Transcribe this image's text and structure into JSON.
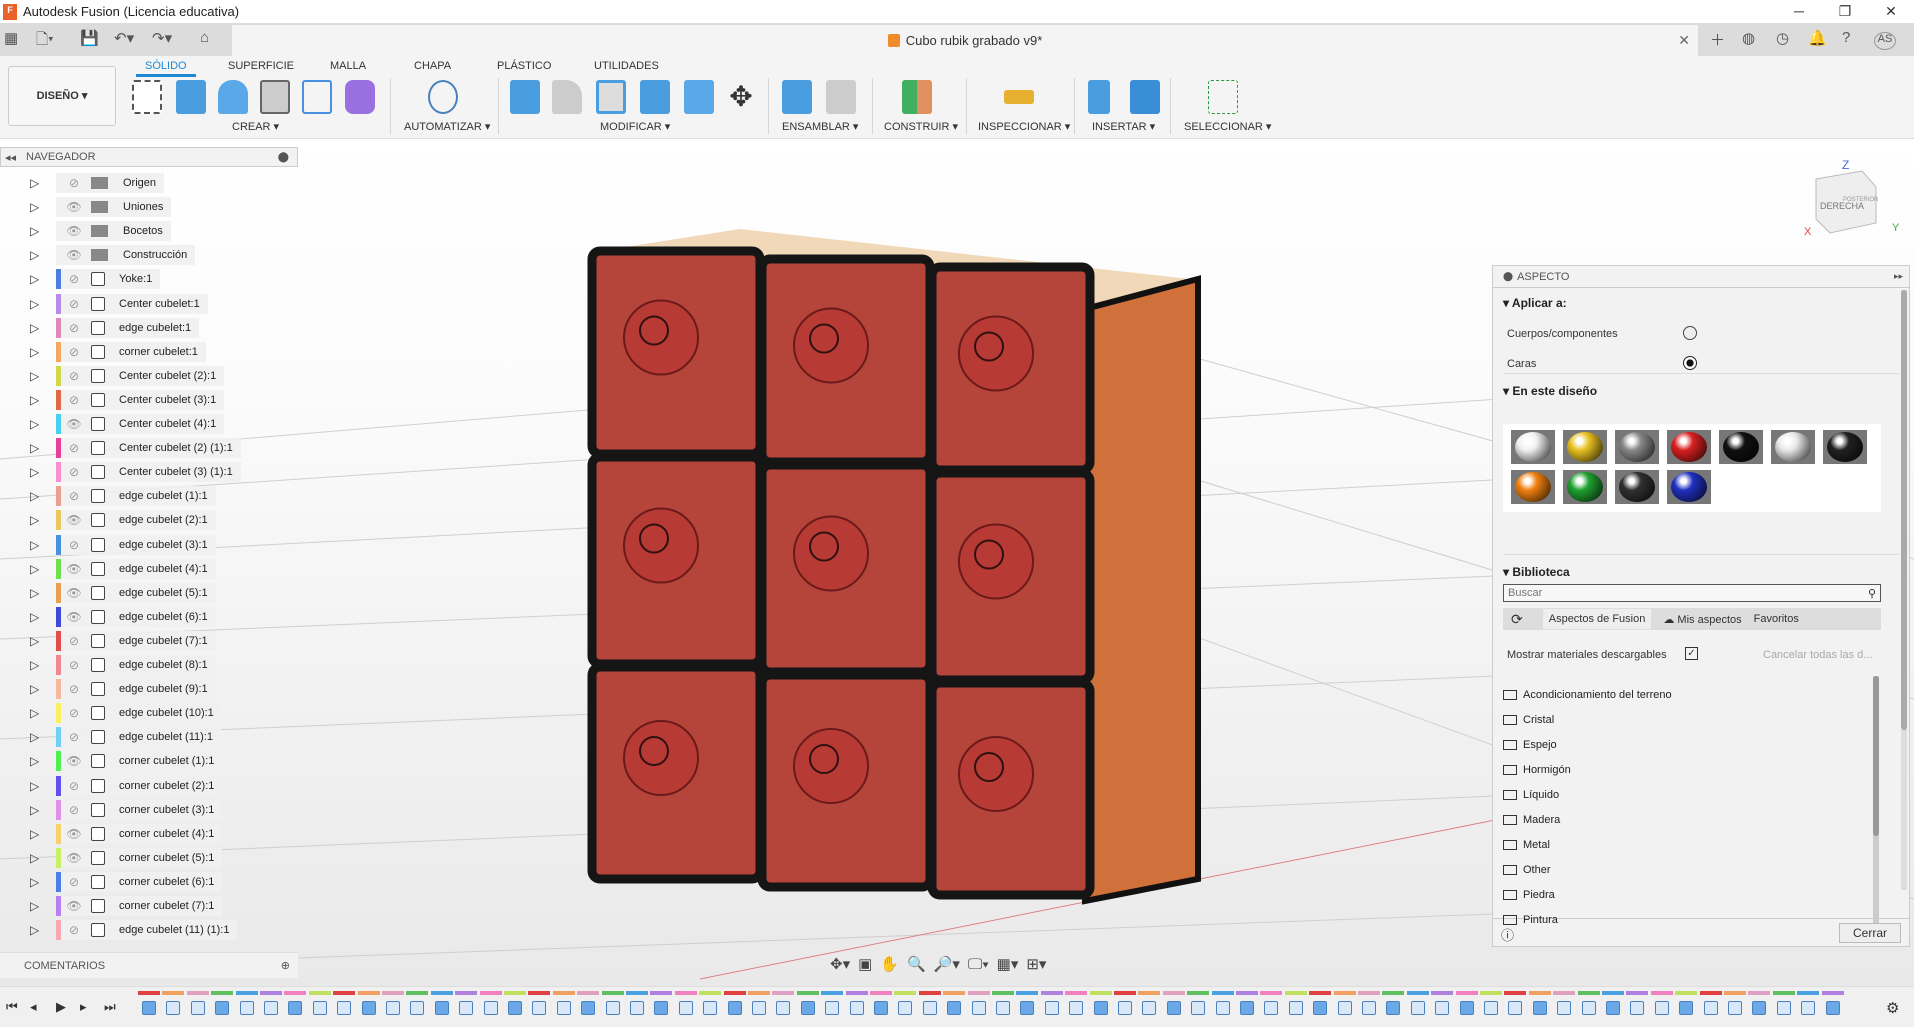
{
  "app": {
    "title": "Autodesk Fusion (Licencia educativa)",
    "document": "Cubo rubik grabado v9*"
  },
  "window": {
    "minimize": "─",
    "maximize": "❐",
    "close": "✕"
  },
  "ribbon": {
    "workspace": "DISEÑO ▾",
    "tabs": [
      {
        "label": "SÓLIDO",
        "active": true
      },
      {
        "label": "SUPERFICIE"
      },
      {
        "label": "MALLA"
      },
      {
        "label": "CHAPA"
      },
      {
        "label": "PLÁSTICO"
      },
      {
        "label": "UTILIDADES"
      }
    ],
    "groups": [
      "CREAR ▾",
      "AUTOMATIZAR ▾",
      "MODIFICAR ▾",
      "ENSAMBLAR ▾",
      "CONSTRUIR ▾",
      "INSPECCIONAR ▾",
      "INSERTAR ▾",
      "SELECCIONAR ▾"
    ]
  },
  "user": {
    "initials": "AS"
  },
  "navigator": {
    "title": "NAVEGADOR",
    "folders": [
      {
        "label": "Origen",
        "visible": false
      },
      {
        "label": "Uniones",
        "visible": true
      },
      {
        "label": "Bocetos",
        "visible": true
      },
      {
        "label": "Construcción",
        "visible": true
      }
    ],
    "components": [
      {
        "label": "Yoke:1",
        "color": "#4a7fe0",
        "visible": false,
        "icon": "body"
      },
      {
        "label": "Center cubelet:1",
        "color": "#b98be8",
        "visible": false,
        "icon": "body"
      },
      {
        "label": "edge cubelet:1",
        "color": "#e08ab8",
        "visible": false,
        "icon": "body"
      },
      {
        "label": "corner cubelet:1",
        "color": "#f7a860",
        "visible": false,
        "icon": "assembly"
      },
      {
        "label": "Center cubelet (2):1",
        "color": "#d0d848",
        "visible": false,
        "icon": "body"
      },
      {
        "label": "Center cubelet (3):1",
        "color": "#e06a48",
        "visible": false,
        "icon": "body"
      },
      {
        "label": "Center cubelet (4):1",
        "color": "#48d0f0",
        "visible": true,
        "icon": "body"
      },
      {
        "label": "Center cubelet (2) (1):1",
        "color": "#e8409a",
        "visible": false,
        "icon": "body"
      },
      {
        "label": "Center cubelet (3) (1):1",
        "color": "#f890d0",
        "visible": false,
        "icon": "body"
      },
      {
        "label": "edge cubelet (1):1",
        "color": "#e8a090",
        "visible": false,
        "icon": "body"
      },
      {
        "label": "edge cubelet (2):1",
        "color": "#e8c860",
        "visible": true,
        "icon": "body"
      },
      {
        "label": "edge cubelet (3):1",
        "color": "#4a90e0",
        "visible": false,
        "icon": "body"
      },
      {
        "label": "edge cubelet (4):1",
        "color": "#70e050",
        "visible": true,
        "icon": "body"
      },
      {
        "label": "edge cubelet (5):1",
        "color": "#e8a050",
        "visible": true,
        "icon": "body"
      },
      {
        "label": "edge cubelet (6):1",
        "color": "#4048d8",
        "visible": true,
        "icon": "body"
      },
      {
        "label": "edge cubelet (7):1",
        "color": "#e05048",
        "visible": false,
        "icon": "body"
      },
      {
        "label": "edge cubelet (8):1",
        "color": "#f08890",
        "visible": false,
        "icon": "body"
      },
      {
        "label": "edge cubelet (9):1",
        "color": "#f8b8a0",
        "visible": false,
        "icon": "body"
      },
      {
        "label": "edge cubelet (10):1",
        "color": "#f8f060",
        "visible": false,
        "icon": "body"
      },
      {
        "label": "edge cubelet (11):1",
        "color": "#70d0f8",
        "visible": false,
        "icon": "body"
      },
      {
        "label": "corner cubelet (1):1",
        "color": "#50f050",
        "visible": true,
        "icon": "assembly"
      },
      {
        "label": "corner cubelet (2):1",
        "color": "#6050f0",
        "visible": false,
        "icon": "assembly"
      },
      {
        "label": "corner cubelet (3):1",
        "color": "#e090e8",
        "visible": false,
        "icon": "assembly"
      },
      {
        "label": "corner cubelet (4):1",
        "color": "#f8d070",
        "visible": true,
        "icon": "assembly"
      },
      {
        "label": "corner cubelet (5):1",
        "color": "#c8f060",
        "visible": true,
        "icon": "assembly"
      },
      {
        "label": "corner cubelet (6):1",
        "color": "#4a80e8",
        "visible": false,
        "icon": "assembly"
      },
      {
        "label": "corner cubelet (7):1",
        "color": "#b880f0",
        "visible": true,
        "icon": "assembly"
      },
      {
        "label": "edge cubelet (11) (1):1",
        "color": "#f8a8b0",
        "visible": false,
        "icon": "body"
      }
    ]
  },
  "comments": {
    "title": "COMENTARIOS"
  },
  "viewcube": {
    "face": "DERECHA",
    "back": "POSTERIOR",
    "z": "Z",
    "x": "X",
    "y": "Y"
  },
  "panel": {
    "title": "ASPECTO",
    "apply_to": {
      "title": "Aplicar a:",
      "options": [
        {
          "label": "Cuerpos/componentes",
          "selected": false
        },
        {
          "label": "Caras",
          "selected": true
        }
      ]
    },
    "in_design": {
      "title": "En este diseño",
      "swatches": [
        "#f0f0f0",
        "#e8c020",
        "#888888",
        "#d82020",
        "#101010",
        "#e8e8e8",
        "#202020",
        "#f08010",
        "#20a030",
        "#303030",
        "#2030c0"
      ]
    },
    "library": {
      "title": "Biblioteca",
      "search_placeholder": "Buscar",
      "tabs": [
        "Aspectos de Fusion",
        "Mis aspectos",
        "Favoritos"
      ],
      "show_downloadable": "Mostrar materiales descargables",
      "show_downloadable_checked": true,
      "cancel_all": "Cancelar todas las d...",
      "folders": [
        "Acondicionamiento del terreno",
        "Cristal",
        "Espejo",
        "Hormigón",
        "Líquido",
        "Madera",
        "Metal",
        "Other",
        "Piedra",
        "Pintura"
      ]
    },
    "close": "Cerrar"
  },
  "colors": {
    "accent": "#1e88d6",
    "cube_face": "#b5443a",
    "cube_side": "#d0703a",
    "cube_top": "#f0d8b8"
  }
}
